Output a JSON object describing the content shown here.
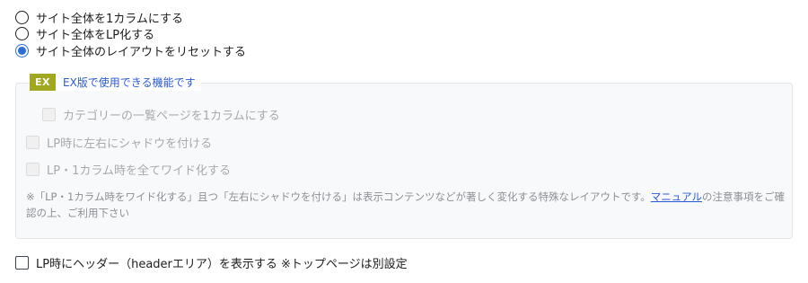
{
  "layout_options": {
    "items": [
      {
        "label": "サイト全体を1カラムにする",
        "selected": false
      },
      {
        "label": "サイト全体をLP化する",
        "selected": false
      },
      {
        "label": "サイト全体のレイアウトをリセットする",
        "selected": true
      }
    ]
  },
  "ex_section": {
    "badge": "EX",
    "title": "EX版で使用できる機能です",
    "options": [
      {
        "label": "カテゴリーの一覧ページを1カラムにする",
        "checked": false,
        "disabled": true
      },
      {
        "label": "LP時に左右にシャドウを付ける",
        "checked": false,
        "disabled": true
      },
      {
        "label": "LP・1カラム時を全てワイド化する",
        "checked": false,
        "disabled": true
      }
    ],
    "note_before": "※「LP・1カラム時をワイド化する」且つ「左右にシャドウを付ける」は表示コンテンツなどが著しく変化する特殊なレイアウトです。",
    "note_link": "マニュアル",
    "note_after": "の注意事項をご確認の上、ご利用下さい"
  },
  "header_option": {
    "label": "LP時にヘッダー（headerエリア）を表示する",
    "suffix": "※トップページは別設定",
    "checked": false
  },
  "colors": {
    "accent": "#2c6fd4",
    "badge": "#a1a81f",
    "link": "#2a5bd7"
  }
}
